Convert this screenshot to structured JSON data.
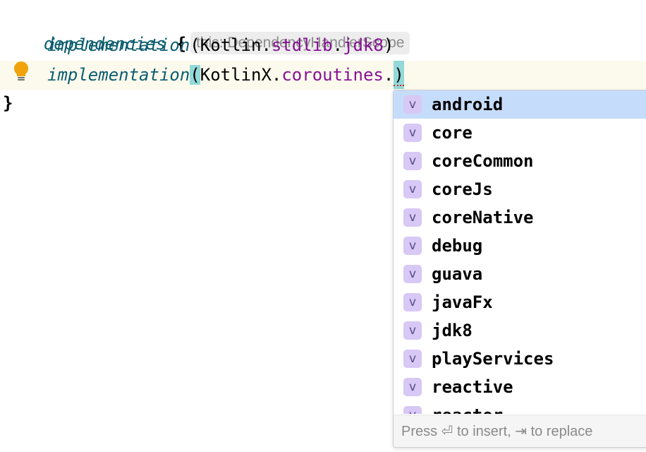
{
  "editor": {
    "line1": {
      "keyword": "dependencies",
      "brace_open": "{",
      "hint": "this: DependencyHandlerScope"
    },
    "line2": {
      "func": "implementation",
      "paren_open": "(",
      "obj": "Kotlin",
      "dot1": ".",
      "member1": "stdlib",
      "dot2": ".",
      "member2": "jdk8",
      "paren_close": ")"
    },
    "line3": {
      "func": "implementation",
      "paren_open": "(",
      "obj": "KotlinX",
      "dot1": ".",
      "member1": "coroutines",
      "dot2": ".",
      "paren_close": ")"
    },
    "line4": {
      "brace_close": "}"
    }
  },
  "completion": {
    "badge": "v",
    "selected_index": 0,
    "items": [
      "android",
      "core",
      "coreCommon",
      "coreJs",
      "coreNative",
      "debug",
      "guava",
      "javaFx",
      "jdk8",
      "playServices",
      "reactive",
      "reactor"
    ],
    "footer": "Press ⏎ to insert, ⇥ to replace"
  },
  "colors": {
    "keyword": "#0b5d6e",
    "member": "#871094",
    "selected_row": "#c6dcfb",
    "badge_bg": "#d7c8f5",
    "paren_highlight": "#93d9d9",
    "bulb": "#f0a30a"
  },
  "icons": {
    "intention": "lightbulb-icon",
    "item_kind": "variable-badge-icon"
  }
}
